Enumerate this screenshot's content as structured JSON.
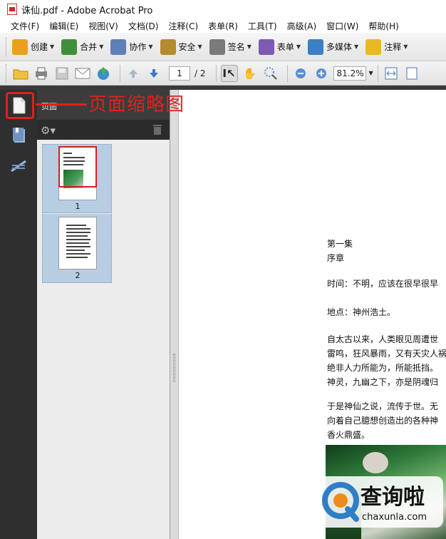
{
  "window": {
    "title": "诛仙.pdf - Adobe Acrobat Pro"
  },
  "menu": [
    "文件(F)",
    "编辑(E)",
    "视图(V)",
    "文档(D)",
    "注释(C)",
    "表单(R)",
    "工具(T)",
    "高级(A)",
    "窗口(W)",
    "帮助(H)"
  ],
  "toolbar1": [
    {
      "label": "创建",
      "icon": "create-icon",
      "color": "#e9a11d"
    },
    {
      "label": "合并",
      "icon": "combine-icon",
      "color": "#3f8f3a"
    },
    {
      "label": "协作",
      "icon": "collaborate-icon",
      "color": "#5f7fb8"
    },
    {
      "label": "安全",
      "icon": "lock-icon",
      "color": "#b68a2e"
    },
    {
      "label": "签名",
      "icon": "pen-icon",
      "color": "#7a7a7a"
    },
    {
      "label": "表单",
      "icon": "form-icon",
      "color": "#7d5bb3"
    },
    {
      "label": "多媒体",
      "icon": "multimedia-icon",
      "color": "#3b7fc4"
    },
    {
      "label": "注释",
      "icon": "comment-icon",
      "color": "#e8b923"
    }
  ],
  "toolbar2": {
    "page_current": "1",
    "page_total": "/ 2",
    "zoom": "81.2%"
  },
  "panel": {
    "title": "页面"
  },
  "thumbnails": [
    {
      "num": "1"
    },
    {
      "num": "2"
    }
  ],
  "annotation": {
    "label": "页面缩略图",
    "color": "#e21f1f"
  },
  "document": {
    "lines": [
      "第一集",
      "序章",
      "时间：不明，应该在很早很早",
      "地点：神州浩土。",
      "自太古以来，人类眼见周遭世",
      "雷鸣，狂风暴雨，又有天灾人祸",
      "绝非人力所能为，所能抵挡。",
      "神灵，九幽之下，亦是阴魂归",
      "于是神仙之说，流传于世。无",
      "向着自己臆想创造出的各种神",
      "香火鼎盛。"
    ]
  },
  "watermark": {
    "brand": "查询啦",
    "url": "chaxunla.com"
  }
}
